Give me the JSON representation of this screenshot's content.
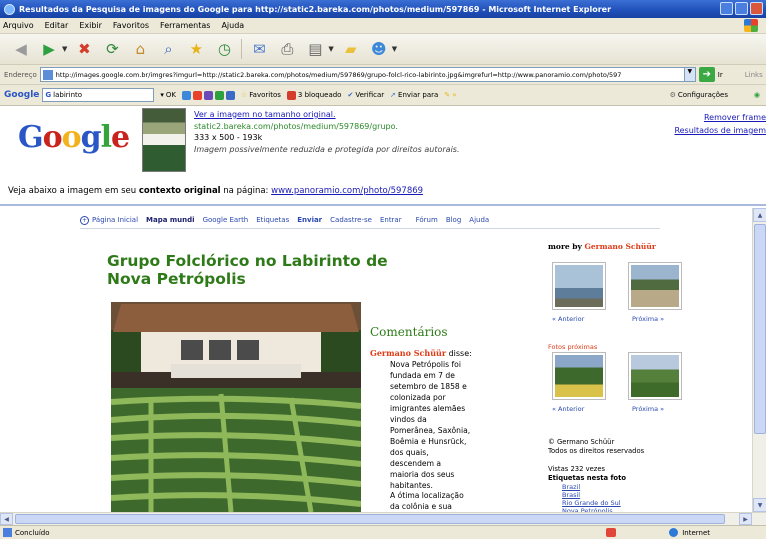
{
  "window": {
    "title": "Resultados da Pesquisa de imagens do Google para http://static2.bareka.com/photos/medium/597869 - Microsoft Internet Explorer"
  },
  "menu": [
    "Arquivo",
    "Editar",
    "Exibir",
    "Favoritos",
    "Ferramentas",
    "Ajuda"
  ],
  "address": {
    "label": "Endereço",
    "url": "http://images.google.com.br/imgres?imgurl=http://static2.bareka.com/photos/medium/597869/grupo-folcl-rico-labirinto.jpg&imgrefurl=http://www.panoramio.com/photo/597",
    "go_label": "Ir",
    "links_label": "Links"
  },
  "google_toolbar": {
    "logo": "Google",
    "search_value": "labirinto",
    "items": [
      "OK",
      "Favoritos",
      "3 bloqueado",
      "Verificar",
      "Enviar para"
    ],
    "config": "Configurações"
  },
  "gframe": {
    "logo_letters": [
      "G",
      "o",
      "o",
      "g",
      "l",
      "e"
    ],
    "view_full": "Ver a imagem no tamanho original.",
    "source_url": "static2.bareka.com/photos/medium/597869/grupo.",
    "dims": "333 x 500 - 193k",
    "notice": "Imagem possivelmente reduzida e protegida por direitos autorais.",
    "remove_frame": "Remover frame",
    "image_results": "Resultados de imagem",
    "context_prefix": "Veja abaixo a imagem em seu",
    "context_bold": "contexto original",
    "context_mid": "na página:",
    "context_link": "www.panoramio.com/photo/597869"
  },
  "pano": {
    "nav": [
      "Página Inicial",
      "Mapa mundi",
      "Google Earth",
      "Etiquetas",
      "Enviar",
      "Cadastre-se",
      "Entrar",
      "Fórum",
      "Blog",
      "Ajuda"
    ],
    "title": "Grupo Folclórico no Labirinto de Nova Petrópolis",
    "comments_title": "Comentários",
    "comment_author": "Germano Schüür",
    "comment_said": " disse:",
    "comment_body": "Nova Petrópolis foi fundada em 7 de setembro de 1858 e colonizada por imigrantes alemães vindos da Pomerânea, Saxônia, Boêmia e Hunsrück, dos quais, descendem a maioria dos seus habitantes.",
    "comment_body2": "A ótima localização da colônia e sua belez",
    "more_by": "more by",
    "more_by_author": "Germano Schüür",
    "anterior": "« Anterior",
    "proxima": "Próxima »",
    "fotos_proximas": "Fotos próximas",
    "copyright_1": "© Germano Schüür",
    "copyright_2": "Todos os direitos reservados",
    "views": "Vistas 232 vezes",
    "tags_title": "Etiquetas nesta foto",
    "tags": [
      "Brazil",
      "Brasil",
      "Rio Grande do Sul",
      "Nova Petrópolis"
    ]
  },
  "status": {
    "text": "Concluído",
    "zone": "Internet"
  }
}
